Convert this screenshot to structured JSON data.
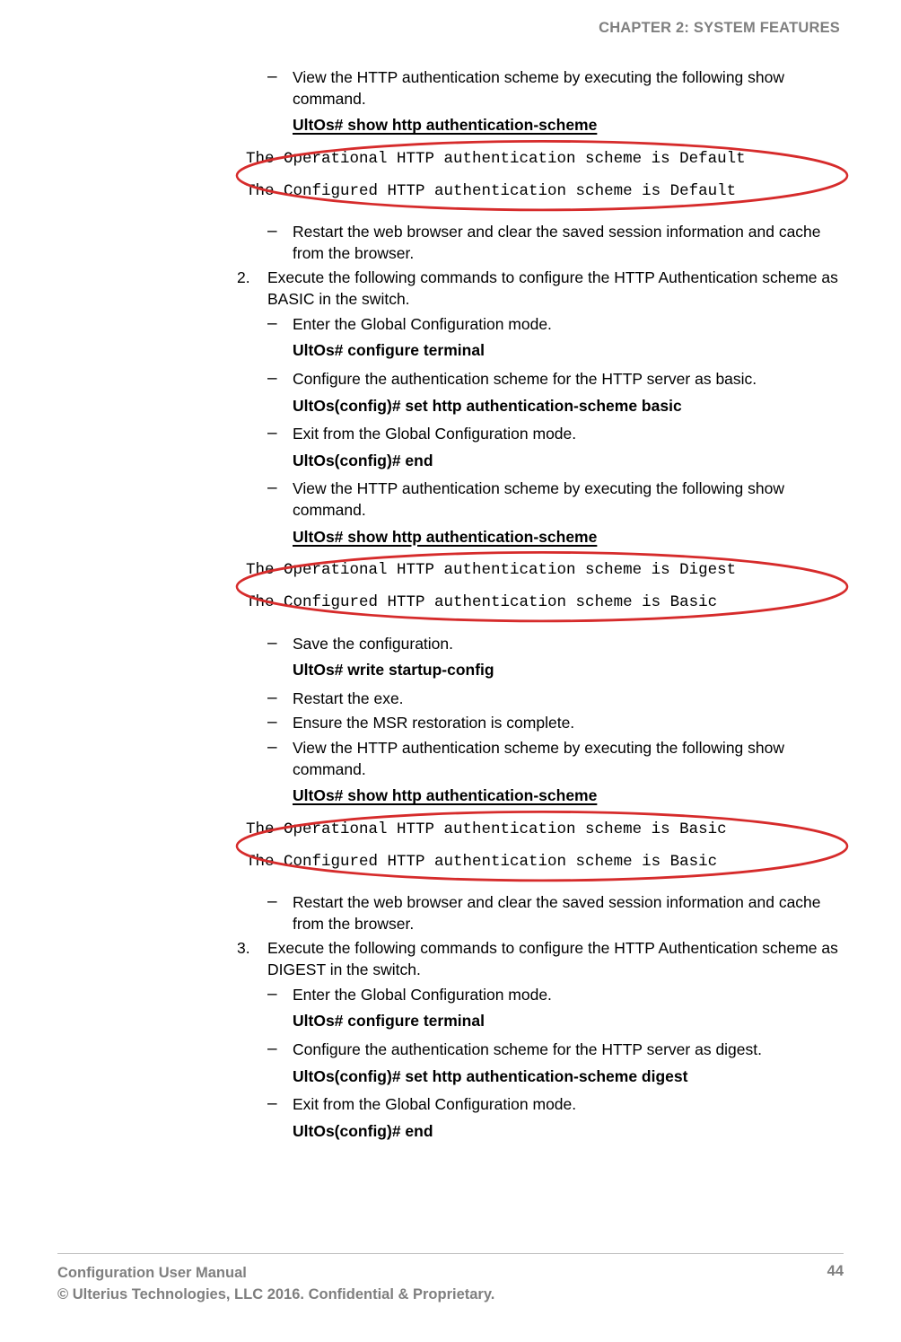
{
  "header": {
    "chapter": "CHAPTER 2: SYSTEM FEATURES"
  },
  "content": {
    "d1": {
      "text": "View the HTTP authentication scheme by executing the following show command."
    },
    "cmd1": "UltOs# show http authentication-scheme",
    "out1": {
      "l1": "The Operational HTTP authentication scheme is Default",
      "l2": "The Configured HTTP authentication scheme is Default"
    },
    "d2": {
      "text": "Restart the web browser and clear the saved session information and cache from the browser."
    },
    "step2": {
      "num": "2.",
      "text": "Execute the following commands to configure the HTTP Authentication scheme as BASIC in the switch."
    },
    "d3": {
      "text": "Enter the Global Configuration mode."
    },
    "cmd2": "UltOs# configure terminal",
    "d4": {
      "text": "Configure the authentication scheme for the HTTP server as basic."
    },
    "cmd3": "UltOs(config)# set http authentication-scheme basic",
    "d5": {
      "text": "Exit from the Global Configuration mode."
    },
    "cmd4": "UltOs(config)# end",
    "d6": {
      "text": "View the HTTP authentication scheme by executing the following show command."
    },
    "cmd5": "UltOs# show http authentication-scheme",
    "out2": {
      "l1": "The Operational HTTP authentication scheme is Digest",
      "l2": "The Configured HTTP authentication scheme is Basic"
    },
    "d7": {
      "text": "Save the configuration."
    },
    "cmd6": "UltOs# write startup-config",
    "d8": {
      "text": "Restart the exe."
    },
    "d9": {
      "text": "Ensure the MSR restoration is complete."
    },
    "d10": {
      "text": "View the HTTP authentication scheme by executing the following show command."
    },
    "cmd7": "UltOs# show http authentication-scheme",
    "out3": {
      "l1": "The Operational HTTP authentication scheme is Basic",
      "l2": "The Configured HTTP authentication scheme is Basic"
    },
    "d11": {
      "text": "Restart the web browser and clear the saved session information and cache from the browser."
    },
    "step3": {
      "num": "3.",
      "text": "Execute the following commands to configure the HTTP Authentication scheme as DIGEST in the switch."
    },
    "d12": {
      "text": "Enter the Global Configuration mode."
    },
    "cmd8": "UltOs# configure terminal",
    "d13": {
      "text": "Configure the authentication scheme for the HTTP server as digest."
    },
    "cmd9": "UltOs(config)# set http authentication-scheme digest",
    "d14": {
      "text": "Exit from the Global Configuration mode."
    },
    "cmd10": "UltOs(config)# end"
  },
  "footer": {
    "title": "Configuration User Manual",
    "copyright": "© Ulterius Technologies, LLC 2016. Confidential & Proprietary.",
    "page": "44"
  },
  "dash": "–"
}
